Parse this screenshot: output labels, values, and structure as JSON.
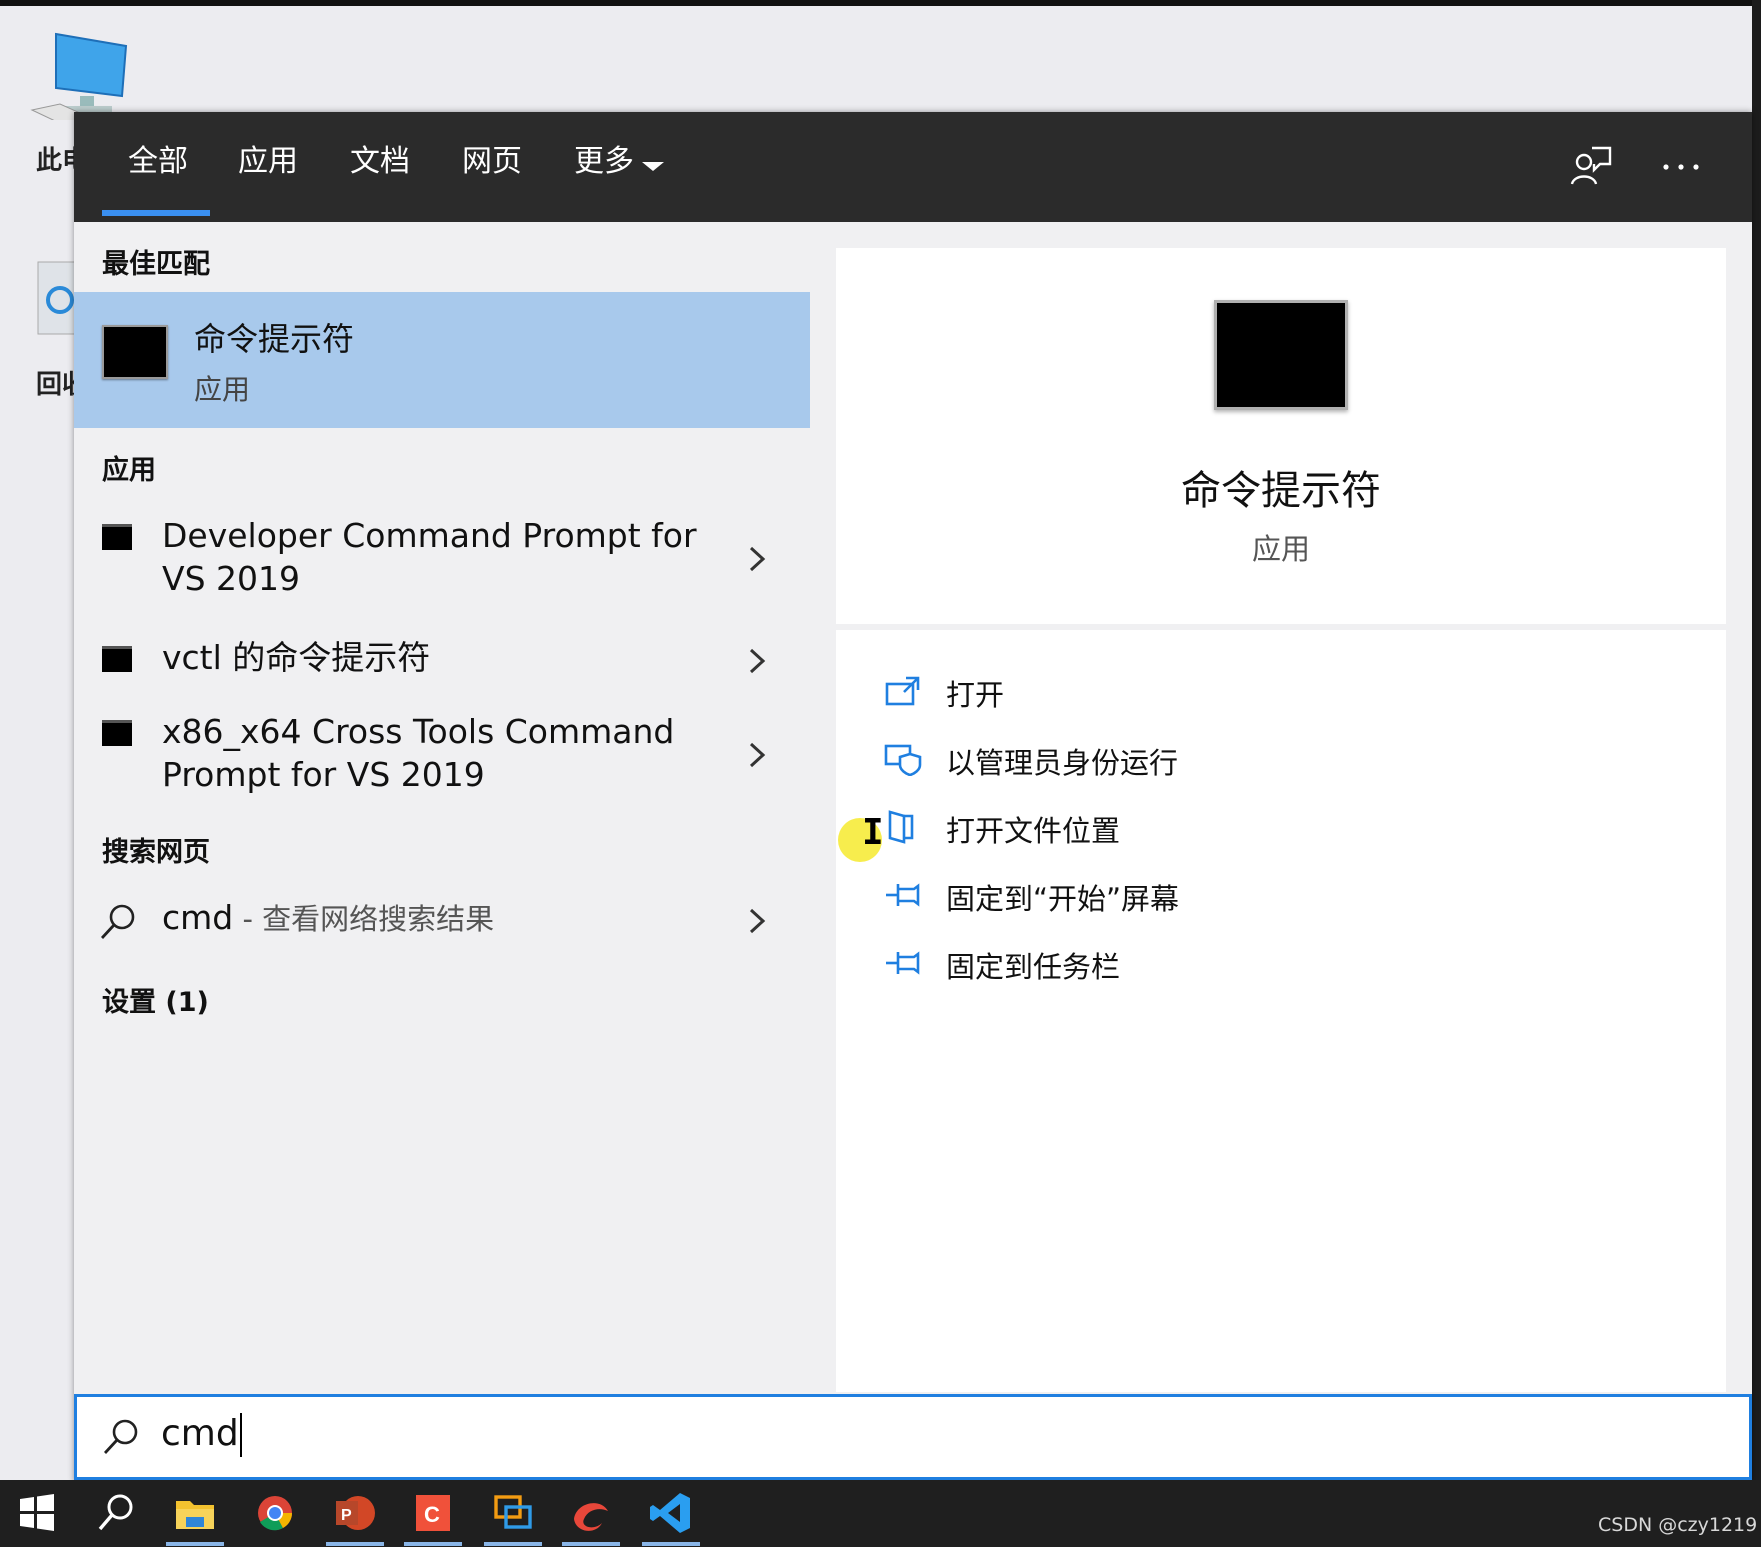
{
  "desktop": {
    "pc_label": "此电",
    "recycle_label": "回收"
  },
  "tabs": {
    "all": "全部",
    "apps": "应用",
    "docs": "文档",
    "web": "网页",
    "more": "更多"
  },
  "sections": {
    "best_match": "最佳匹配",
    "apps": "应用",
    "search_web": "搜索网页",
    "settings": "设置 (1)"
  },
  "best_match": {
    "title": "命令提示符",
    "subtitle": "应用"
  },
  "apps": [
    {
      "label": "Developer Command Prompt for VS 2019"
    },
    {
      "label": "vctl 的命令提示符"
    },
    {
      "label": "x86_x64 Cross Tools Command Prompt for VS 2019"
    }
  ],
  "web_search": {
    "query": "cmd",
    "hint": " - 查看网络搜索结果"
  },
  "detail": {
    "title": "命令提示符",
    "subtitle": "应用",
    "actions": [
      {
        "label": "打开",
        "icon": "open-icon"
      },
      {
        "label": "以管理员身份运行",
        "icon": "shield-icon"
      },
      {
        "label": "打开文件位置",
        "icon": "folder-location-icon"
      },
      {
        "label": "固定到“开始”屏幕",
        "icon": "pin-icon"
      },
      {
        "label": "固定到任务栏",
        "icon": "pin-icon"
      }
    ]
  },
  "search": {
    "value": "cmd"
  },
  "taskbar": {
    "icons": [
      "windows-start-icon",
      "search-icon",
      "file-explorer-icon",
      "chrome-icon",
      "powerpoint-icon",
      "clion-icon",
      "remote-desktop-icon",
      "app-icon",
      "vscode-icon"
    ]
  },
  "watermark": "CSDN @czy1219",
  "colors": {
    "accent": "#1f7fe0",
    "selection": "#a8c9ec",
    "topbar": "#2b2b2b",
    "taskbar": "#1f1f1f"
  }
}
